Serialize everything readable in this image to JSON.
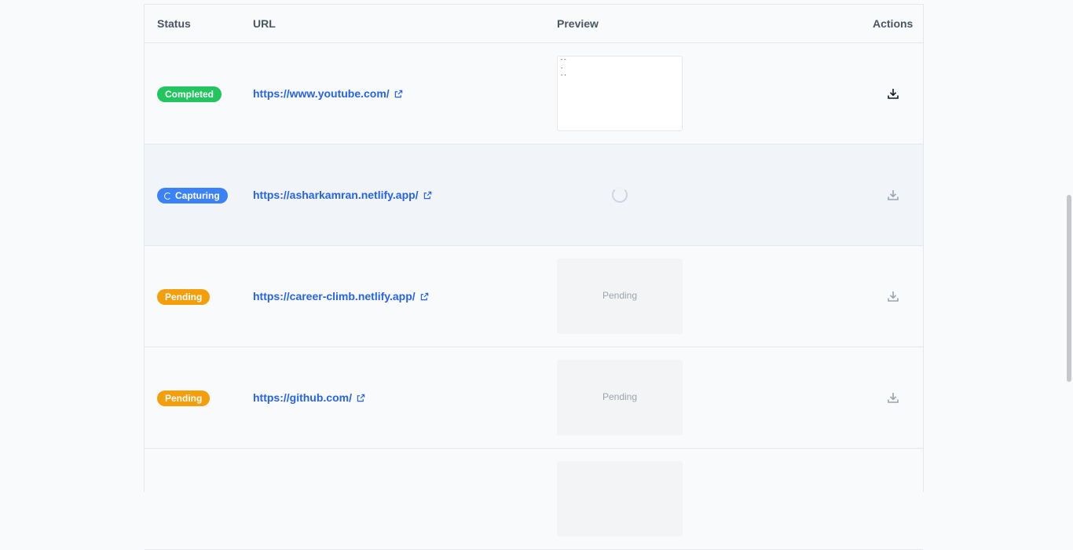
{
  "table": {
    "headers": {
      "status": "Status",
      "url": "URL",
      "preview": "Preview",
      "actions": "Actions"
    },
    "rows": [
      {
        "status": "Completed",
        "url": "https://www.youtube.com/",
        "preview_lines": [
          "--",
          ".",
          ".."
        ],
        "preview_text": ""
      },
      {
        "status": "Capturing",
        "url": "https://asharkamran.netlify.app/",
        "preview_text": ""
      },
      {
        "status": "Pending",
        "url": "https://career-climb.netlify.app/",
        "preview_text": "Pending"
      },
      {
        "status": "Pending",
        "url": "https://github.com/",
        "preview_text": "Pending"
      }
    ]
  },
  "icons": {
    "download": "download-icon",
    "external_link": "external-link-icon",
    "spinner": "loading-spinner-icon"
  },
  "colors": {
    "completed": "#22c55e",
    "capturing": "#3b82f6",
    "pending": "#f59e0b",
    "link": "#2563eb"
  }
}
